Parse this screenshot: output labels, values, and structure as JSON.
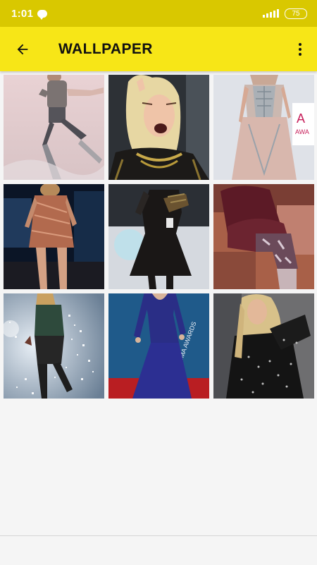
{
  "status_bar": {
    "time": "1:01",
    "battery": "75",
    "icons": [
      "chat-notification-icon",
      "signal-icon",
      "battery-icon"
    ]
  },
  "app_bar": {
    "title": "WALLPAPER",
    "back_icon": "arrow-back-icon",
    "menu_icon": "more-vert-icon"
  },
  "colors": {
    "status_bar": "#d9c800",
    "app_bar": "#f7e617",
    "background": "#f5f5f5"
  },
  "wallpapers": [
    {
      "alt": "wallpaper-1"
    },
    {
      "alt": "wallpaper-2"
    },
    {
      "alt": "wallpaper-3",
      "sign_text": "A\nAWA"
    },
    {
      "alt": "wallpaper-4"
    },
    {
      "alt": "wallpaper-5"
    },
    {
      "alt": "wallpaper-6"
    },
    {
      "alt": "wallpaper-7"
    },
    {
      "alt": "wallpaper-8",
      "sign_text": "CMA AWARDS"
    },
    {
      "alt": "wallpaper-9"
    }
  ]
}
